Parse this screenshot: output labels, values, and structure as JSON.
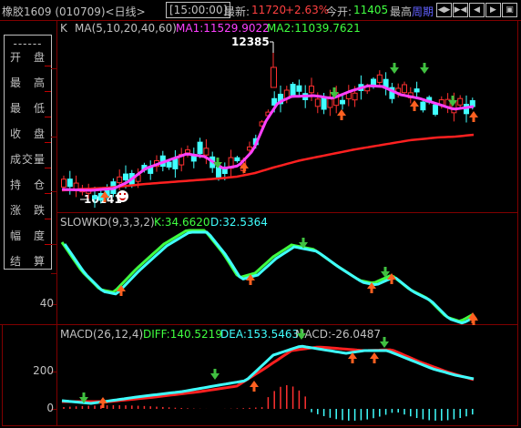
{
  "topbar": {
    "stock_name": "橡胶1609 (010709)<日线>",
    "time": "[15:00:00]",
    "latest_label": "最新:",
    "latest_value": "11720",
    "change": "+2.63%",
    "open_label": "今开:",
    "open_value": "11405",
    "high_label": "最高",
    "period_label": "周期",
    "nav_buttons": [
      "◀▶",
      "▶◀",
      "◀",
      "▶",
      "▣"
    ]
  },
  "left_panel": {
    "header": "------",
    "items": [
      "开　盘",
      "最　高",
      "最　低",
      "收　盘",
      "成交量",
      "持　仓",
      "涨　跌",
      "幅　度",
      "结　算"
    ]
  },
  "main_panel": {
    "label_k": "K",
    "ma_label": "MA(5,10,20,40,60)",
    "ma1": "MA1:11529.9022",
    "ma2": "MA2:11039.7621",
    "high_marker": "12385",
    "low_marker": "10141",
    "smiley_icon": "smiley-face-icon"
  },
  "kd_panel": {
    "label": "SLOWKD(9,3,3,2)",
    "k": "K:34.6620",
    "d": "D:32.5364",
    "y_label": "40"
  },
  "macd_panel": {
    "label": "MACD(26,12,4)",
    "diff": "DIFF:140.5219",
    "dea": "DEA:153.5463",
    "macd": "MACD:-26.0487",
    "y_labels": [
      "200",
      "0"
    ]
  },
  "colors": {
    "up": "#ff3030",
    "down": "#40ffff",
    "ma1": "#ff40ff",
    "ma2": "#ff2020",
    "k_line": "#40ffff",
    "d_line": "#ff2020",
    "frame": "#800000",
    "period": "#6060ff"
  }
}
